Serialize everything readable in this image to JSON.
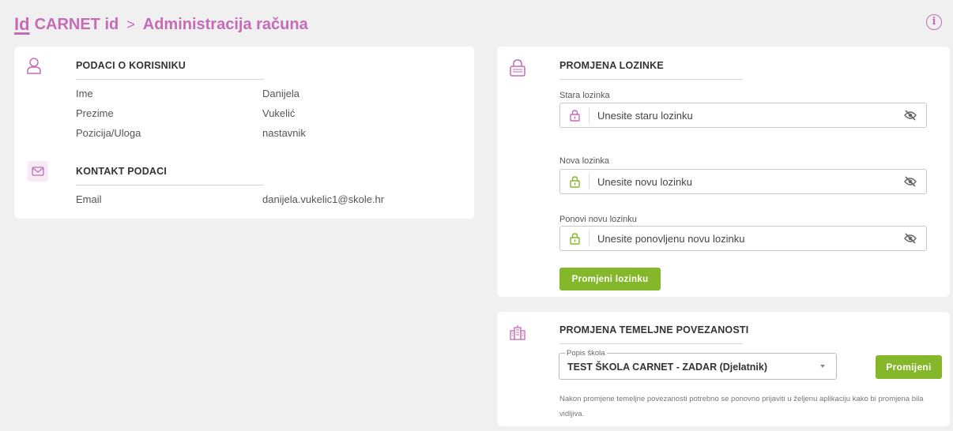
{
  "header": {
    "logo": "Id",
    "app_name": "CARNET id",
    "separator": ">",
    "page": "Administracija računa",
    "info_icon": "info-icon"
  },
  "user_card": {
    "user_section": {
      "icon": "user-icon",
      "title": "PODACI O KORISNIKU",
      "rows": [
        {
          "label": "Ime",
          "value": "Danijela"
        },
        {
          "label": "Prezime",
          "value": "Vukelić"
        },
        {
          "label": "Pozicija/Uloga",
          "value": "nastavnik"
        }
      ]
    },
    "contact_section": {
      "icon": "mail-icon",
      "title": "KONTAKT PODACI",
      "rows": [
        {
          "label": "Email",
          "value": "danijela.vukelic1@skole.hr"
        }
      ]
    }
  },
  "password_card": {
    "icon": "lock-icon",
    "title": "PROMJENA LOZINKE",
    "fields": [
      {
        "label": "Stara lozinka",
        "placeholder": "Unesite staru lozinku",
        "lock_color": "#c46cb8"
      },
      {
        "label": "Nova lozinka",
        "placeholder": "Unesite novu lozinku",
        "lock_color": "#85b72b"
      },
      {
        "label": "Ponovi novu lozinku",
        "placeholder": "Unesite ponovljenu novu lozinku",
        "lock_color": "#85b72b"
      }
    ],
    "submit_label": "Promjeni lozinku"
  },
  "school_card": {
    "icon": "school-building-icon",
    "title": "PROMJENA TEMELJNE POVEZANOSTI",
    "select_legend": "Popis škola",
    "select_value": "TEST ŠKOLA CARNET - ZADAR (Djelatnik)",
    "button_label": "Promijeni",
    "note": "Nakon promjene temeljne povezanosti potrebno se ponovno prijaviti u željenu aplikaciju kako bi promjena bila vidljiva."
  },
  "colors": {
    "accent": "#c46cb8",
    "button": "#85b72b",
    "background": "#f0f0f0"
  }
}
